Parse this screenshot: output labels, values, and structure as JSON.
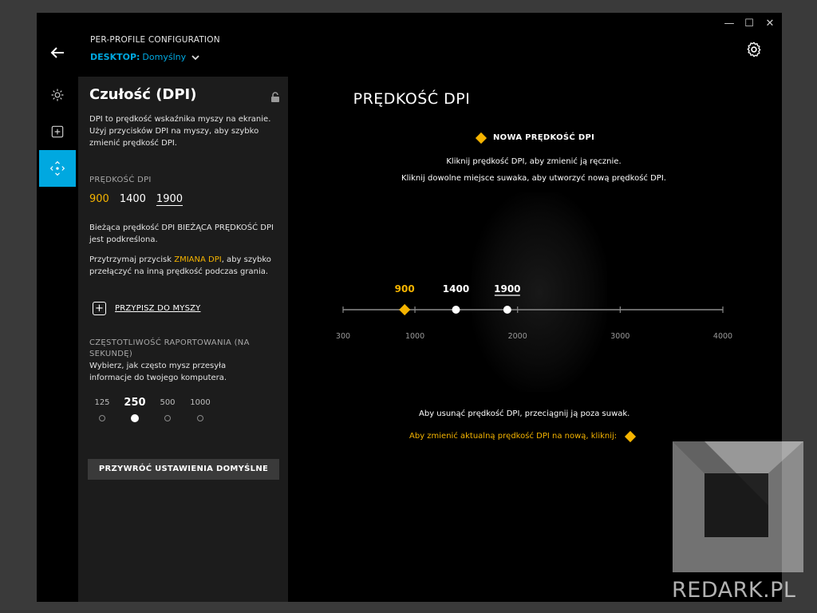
{
  "window": {
    "minimize_glyph": "—",
    "maximize_glyph": "☐",
    "close_glyph": "✕"
  },
  "header": {
    "subtitle": "PER-PROFILE CONFIGURATION",
    "profile_label": "DESKTOP:",
    "profile_value": "Domyślny"
  },
  "rail": {
    "items": [
      {
        "icon": "lighting-icon",
        "active": false
      },
      {
        "icon": "assignments-icon",
        "active": false
      },
      {
        "icon": "pointer-settings-icon",
        "active": true
      }
    ]
  },
  "panel": {
    "title": "Czułość (DPI)",
    "description": "DPI to prędkość wskaźnika myszy na ekranie. Użyj przycisków DPI na myszy, aby szybko zmienić prędkość DPI.",
    "dpi_heading": "PRĘDKOŚĆ DPI",
    "dpi_values": [
      "900",
      "1400",
      "1900"
    ],
    "current_text": "Bieżąca prędkość DPI BIEŻĄCA PRĘDKOŚĆ DPI jest podkreślona.",
    "shift_prefix": "Przytrzymaj przycisk ",
    "shift_accent": "ZMIANA DPI",
    "shift_suffix": ", aby szybko przełączyć na inną prędkość podczas grania.",
    "assign_label": "PRZYPISZ DO MYSZY",
    "report_heading": "CZĘSTOTLIWOŚĆ RAPORTOWANIA (NA SEKUNDĘ)",
    "report_desc": "Wybierz, jak często mysz przesyła informacje do twojego komputera.",
    "report_rates": [
      "125",
      "250",
      "500",
      "1000"
    ],
    "report_selected": "250",
    "reset_label": "PRZYWRÓĆ USTAWIENIA DOMYŚLNE"
  },
  "main": {
    "title": "PRĘDKOŚĆ DPI",
    "new_dpi_label": "NOWA PRĘDKOŚĆ DPI",
    "instr_1": "Kliknij prędkość DPI, aby zmienić ją ręcznie.",
    "instr_2": "Kliknij dowolne miejsce suwaka, aby utworzyć nową prędkość DPI.",
    "footer_1": "Aby usunąć prędkość DPI, przeciągnij ją poza suwak.",
    "footer_2": "Aby zmienić aktualną prędkość DPI na nową, kliknij:"
  },
  "slider": {
    "min": 300,
    "max": 4000,
    "scale_labels": [
      300,
      1000,
      2000,
      3000,
      4000
    ],
    "points": [
      {
        "value": 900,
        "label": "900",
        "kind": "shift"
      },
      {
        "value": 1400,
        "label": "1400",
        "kind": "normal"
      },
      {
        "value": 1900,
        "label": "1900",
        "kind": "current"
      }
    ]
  },
  "watermark": {
    "text": "REDARK.PL"
  },
  "colors": {
    "accent": "#f5b400",
    "brand_blue": "#00a8e0"
  }
}
